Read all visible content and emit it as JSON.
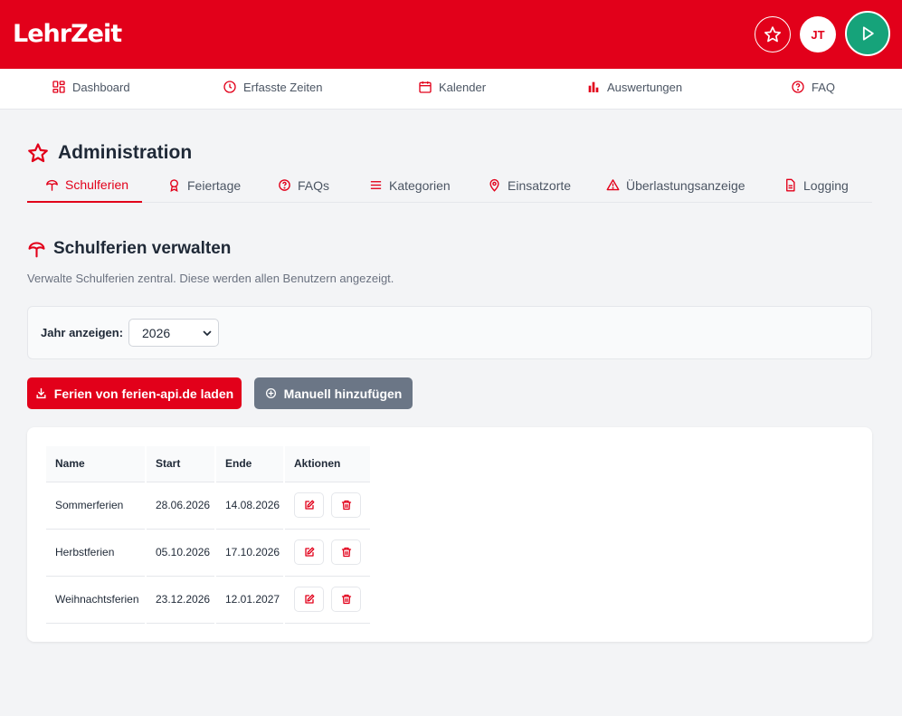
{
  "header": {
    "logo_text_left": "Lehr",
    "logo_text_right": "Zeit",
    "user_initials": "JT",
    "icons": [
      "star-icon",
      "play-icon"
    ]
  },
  "nav": {
    "items": [
      {
        "label": "Dashboard",
        "icon": "dashboard-icon"
      },
      {
        "label": "Erfasste Zeiten",
        "icon": "clock-icon"
      },
      {
        "label": "Kalender",
        "icon": "calendar-icon"
      },
      {
        "label": "Auswertungen",
        "icon": "bar-chart-icon"
      },
      {
        "label": "FAQ",
        "icon": "question-icon"
      }
    ]
  },
  "admin": {
    "title": "Administration",
    "tabs": [
      {
        "label": "Schulferien",
        "icon": "umbrella-icon",
        "active": true
      },
      {
        "label": "Feiertage",
        "icon": "ribbon-icon"
      },
      {
        "label": "FAQs",
        "icon": "question-icon"
      },
      {
        "label": "Kategorien",
        "icon": "list-icon"
      },
      {
        "label": "Einsatzorte",
        "icon": "location-pin-icon"
      },
      {
        "label": "Überlastungsanzeige",
        "icon": "warning-icon"
      },
      {
        "label": "Logging",
        "icon": "document-icon"
      }
    ]
  },
  "section": {
    "title": "Schulferien verwalten",
    "description": "Verwalte Schulferien zentral. Diese werden allen Benutzern angezeigt."
  },
  "filter": {
    "label": "Jahr anzeigen:",
    "selected_year": "2026"
  },
  "buttons": {
    "load_label": "Ferien von ferien-api.de laden",
    "add_label": "Manuell hinzufügen"
  },
  "table": {
    "columns": [
      "Name",
      "Start",
      "Ende",
      "Aktionen"
    ],
    "rows": [
      {
        "name": "Sommerferien",
        "start": "28.06.2026",
        "end": "14.08.2026"
      },
      {
        "name": "Herbstferien",
        "start": "05.10.2026",
        "end": "17.10.2026"
      },
      {
        "name": "Weihnachtsferien",
        "start": "23.12.2026",
        "end": "12.01.2027"
      }
    ]
  },
  "colors": {
    "brand_red": "#e2001a",
    "play_green": "#16a37a",
    "secondary_gray": "#6b7686"
  }
}
